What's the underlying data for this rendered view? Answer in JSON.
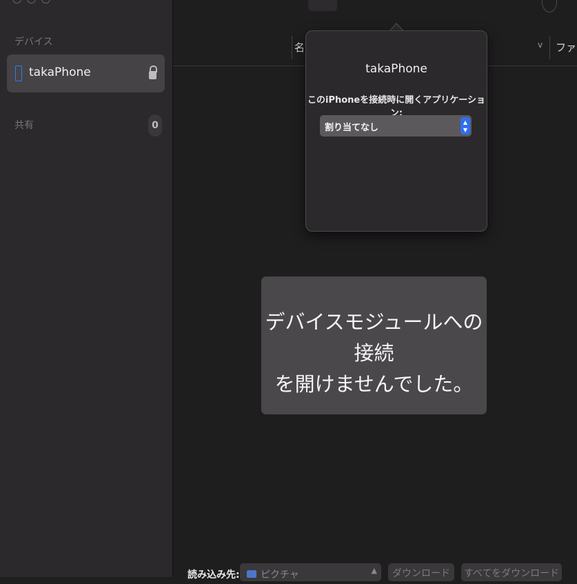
{
  "sidebar": {
    "devices_title": "デバイス",
    "device": {
      "name": "takaPhone"
    },
    "shared_title": "共有",
    "shared_count": "0"
  },
  "table": {
    "col_name": "名前",
    "col_file": "ファイ"
  },
  "popover": {
    "title": "takaPhone",
    "label": "このiPhoneを接続時に開くアプリケーション:",
    "select_value": "割り当てなし"
  },
  "error": {
    "line1": "デバイスモジュールへの接続",
    "line2": "を開けませんでした。"
  },
  "bottom": {
    "import_label": "読み込み先:",
    "destination": "ピクチャ",
    "download_label": "ダウンロード",
    "download_all_label": "すべてをダウンロード"
  },
  "colors": {
    "accent": "#2f6ff0",
    "sidebar_bg": "#2b292b",
    "main_bg": "#1f1e1f",
    "selection_bg": "#454345"
  },
  "icons": [
    "phone-icon",
    "lock-icon",
    "folder-icon",
    "chevron-updown-icon"
  ]
}
